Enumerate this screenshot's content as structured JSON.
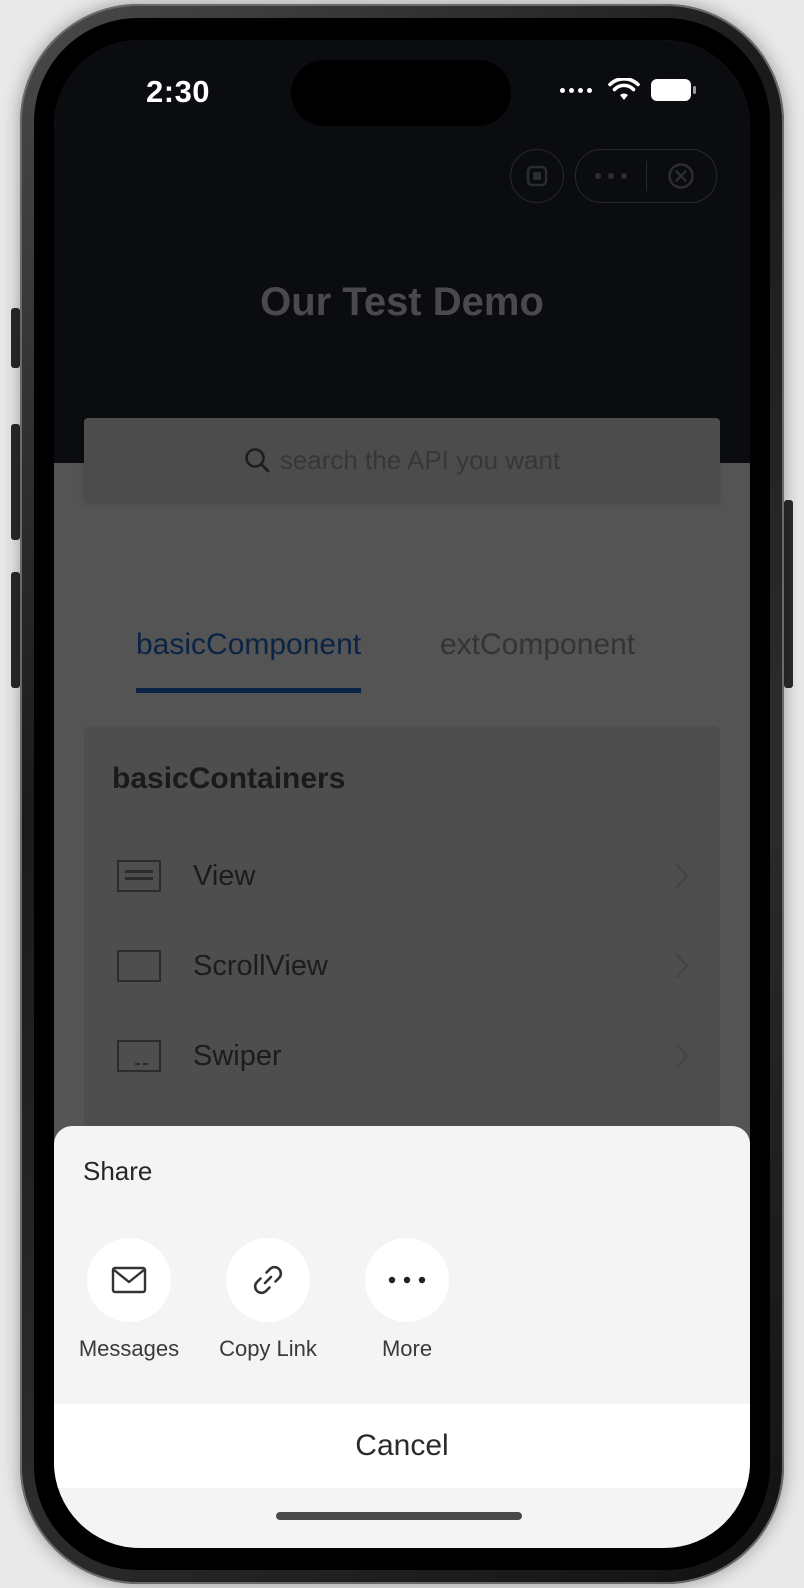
{
  "status_bar": {
    "time": "2:30"
  },
  "header": {
    "title": "Our Test Demo"
  },
  "search": {
    "placeholder": "search the API you want"
  },
  "tabs": [
    {
      "label": "basicComponent",
      "active": true
    },
    {
      "label": "extComponent",
      "active": false
    }
  ],
  "section": {
    "title": "basicContainers",
    "items": [
      {
        "label": "View",
        "icon": "view-icon"
      },
      {
        "label": "ScrollView",
        "icon": "scroll-view-icon"
      },
      {
        "label": "Swiper",
        "icon": "swiper-icon"
      }
    ]
  },
  "share_sheet": {
    "title": "Share",
    "actions": [
      {
        "label": "Messages",
        "icon": "envelope-icon"
      },
      {
        "label": "Copy Link",
        "icon": "link-icon"
      },
      {
        "label": "More",
        "icon": "more-icon"
      }
    ],
    "cancel_label": "Cancel"
  },
  "colors": {
    "accent": "#0b2446",
    "overlay": "#545454",
    "sheet_background": "#f4f4f4"
  }
}
